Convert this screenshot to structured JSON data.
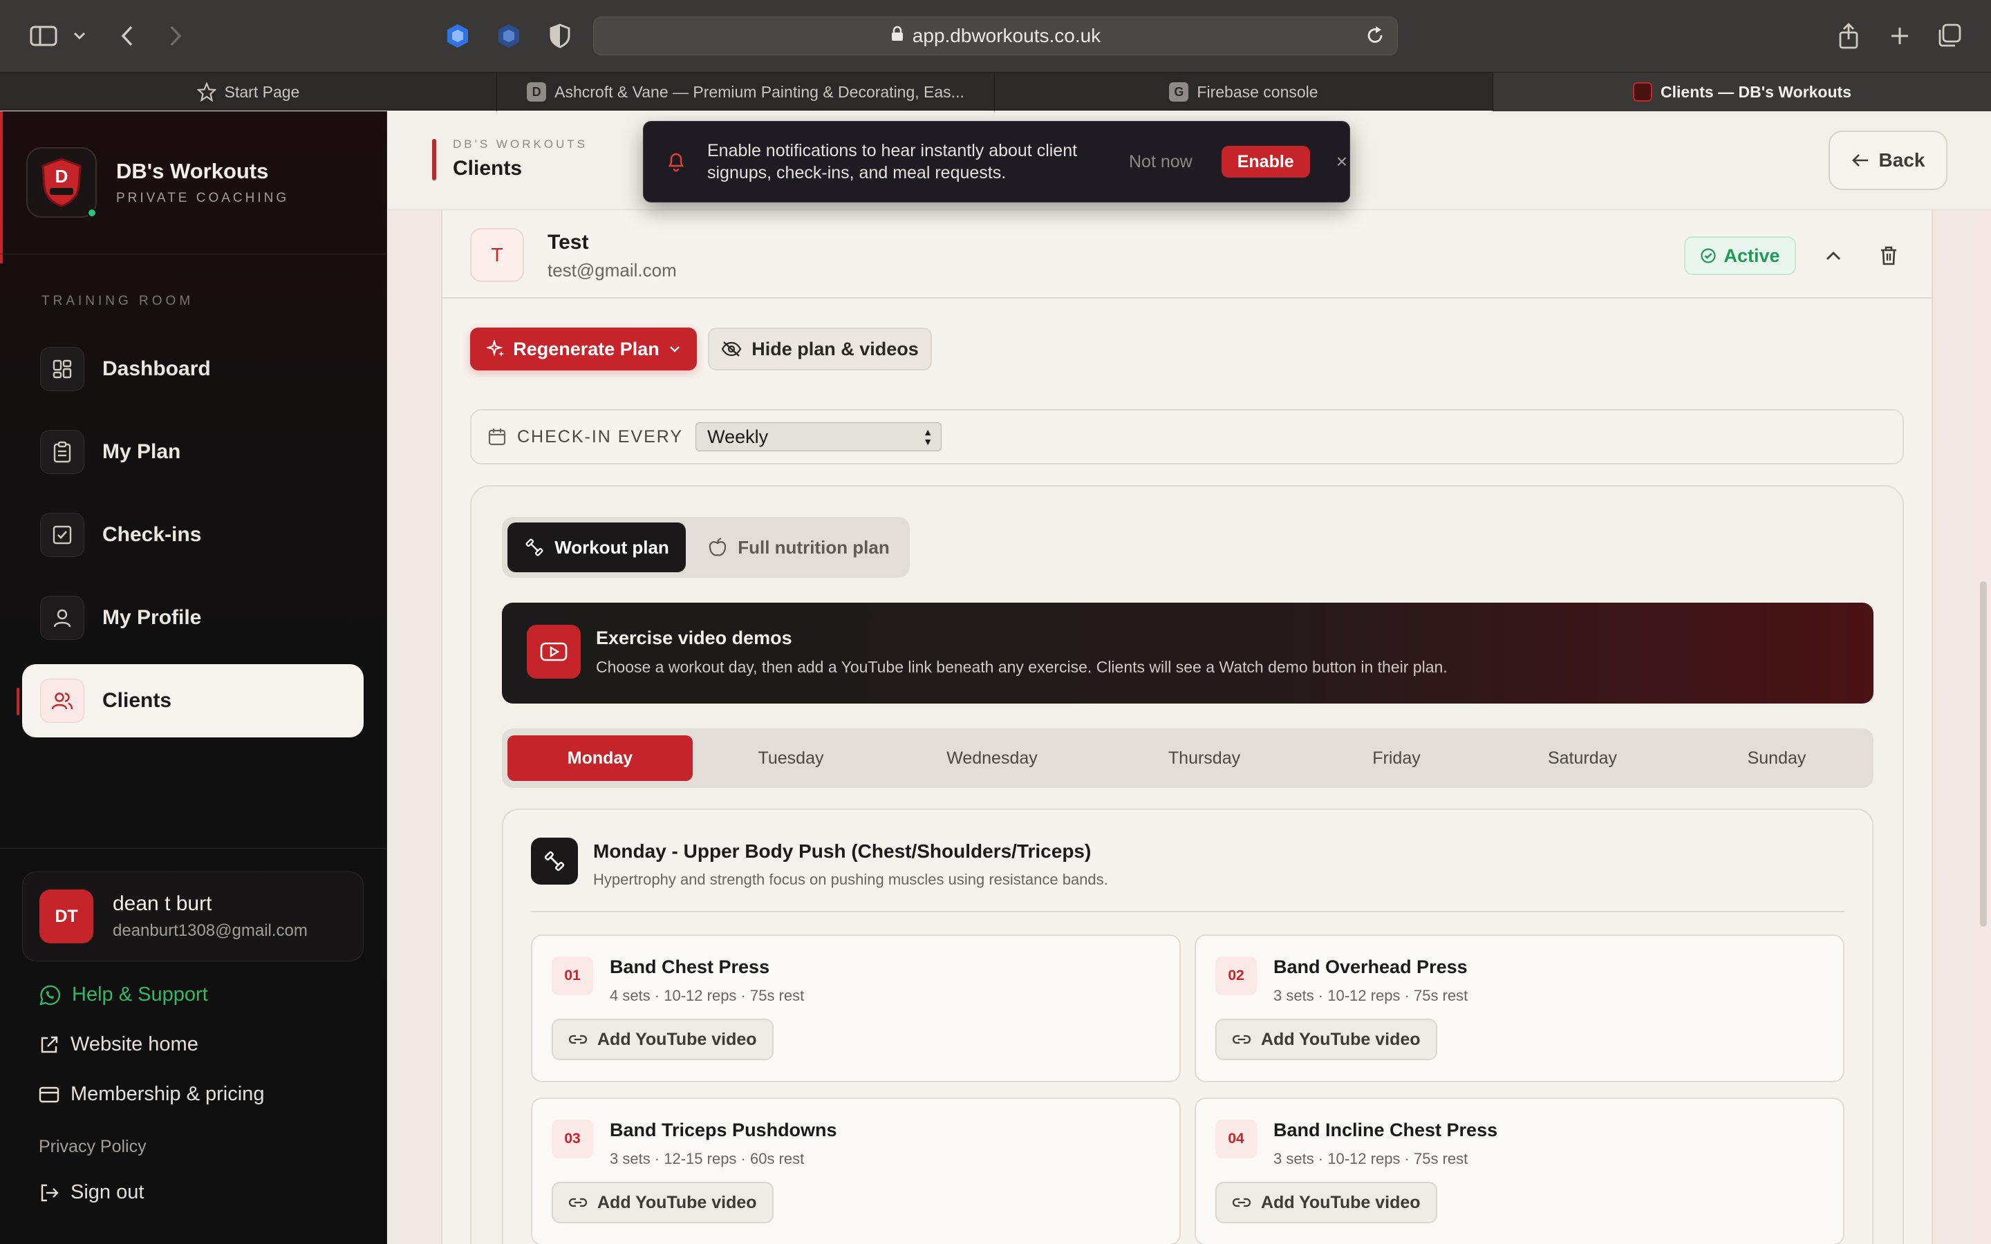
{
  "browser": {
    "url": "app.dbworkouts.co.uk",
    "tabs": [
      {
        "label": "Start Page",
        "favicon": "star-icon"
      },
      {
        "label": "Ashcroft & Vane — Premium Painting & Decorating, Eas...",
        "favicon": "D"
      },
      {
        "label": "Firebase console",
        "favicon": "G"
      },
      {
        "label": "Clients — DB's Workouts",
        "favicon": "db-logo"
      }
    ]
  },
  "sidebar": {
    "brand_name": "DB's Workouts",
    "brand_sub": "PRIVATE COACHING",
    "section": "TRAINING ROOM",
    "items": [
      {
        "label": "Dashboard",
        "icon": "grid-icon"
      },
      {
        "label": "My Plan",
        "icon": "clipboard-icon"
      },
      {
        "label": "Check-ins",
        "icon": "checkbox-icon"
      },
      {
        "label": "My Profile",
        "icon": "user-icon"
      },
      {
        "label": "Clients",
        "icon": "users-icon"
      }
    ],
    "user": {
      "initials": "DT",
      "name": "dean t burt",
      "email": "deanburt1308@gmail.com"
    },
    "links": {
      "help": "Help & Support",
      "website": "Website home",
      "membership": "Membership & pricing",
      "privacy": "Privacy Policy",
      "signout": "Sign out"
    }
  },
  "header": {
    "sub": "DB'S WORKOUTS",
    "title": "Clients",
    "back_label": "Back"
  },
  "notification": {
    "text": "Enable notifications to hear instantly about client signups, check-ins, and meal requests.",
    "not_now": "Not now",
    "enable": "Enable",
    "close": "×"
  },
  "client": {
    "initial": "T",
    "name": "Test",
    "email": "test@gmail.com",
    "status": "Active",
    "regenerate_label": "Regenerate Plan",
    "hide_label": "Hide plan & videos",
    "checkin_label": "CHECK-IN EVERY",
    "checkin_value": "Weekly"
  },
  "plan": {
    "tabs": {
      "workout": "Workout plan",
      "nutrition": "Full nutrition plan"
    },
    "demo_title": "Exercise video demos",
    "demo_desc": "Choose a workout day, then add a YouTube link beneath any exercise. Clients will see a Watch demo button in their plan.",
    "days": [
      "Monday",
      "Tuesday",
      "Wednesday",
      "Thursday",
      "Friday",
      "Saturday",
      "Sunday"
    ],
    "selected_day": "Monday",
    "day_title": "Monday - Upper Body Push (Chest/Shoulders/Triceps)",
    "day_desc": "Hypertrophy and strength focus on pushing muscles using resistance bands.",
    "exercises": [
      {
        "num": "01",
        "name": "Band Chest Press",
        "meta": "4 sets · 10-12 reps · 75s rest",
        "cta": "Add YouTube video"
      },
      {
        "num": "02",
        "name": "Band Overhead Press",
        "meta": "3 sets · 10-12 reps · 75s rest",
        "cta": "Add YouTube video"
      },
      {
        "num": "03",
        "name": "Band Triceps Pushdowns",
        "meta": "3 sets · 12-15 reps · 60s rest",
        "cta": "Add YouTube video"
      },
      {
        "num": "04",
        "name": "Band Incline Chest Press",
        "meta": "3 sets · 10-12 reps · 75s rest",
        "cta": "Add YouTube video"
      }
    ]
  },
  "colors": {
    "accent": "#c4242a",
    "success": "#1f9a55",
    "sidebar_bg": "#0f0f0f"
  }
}
